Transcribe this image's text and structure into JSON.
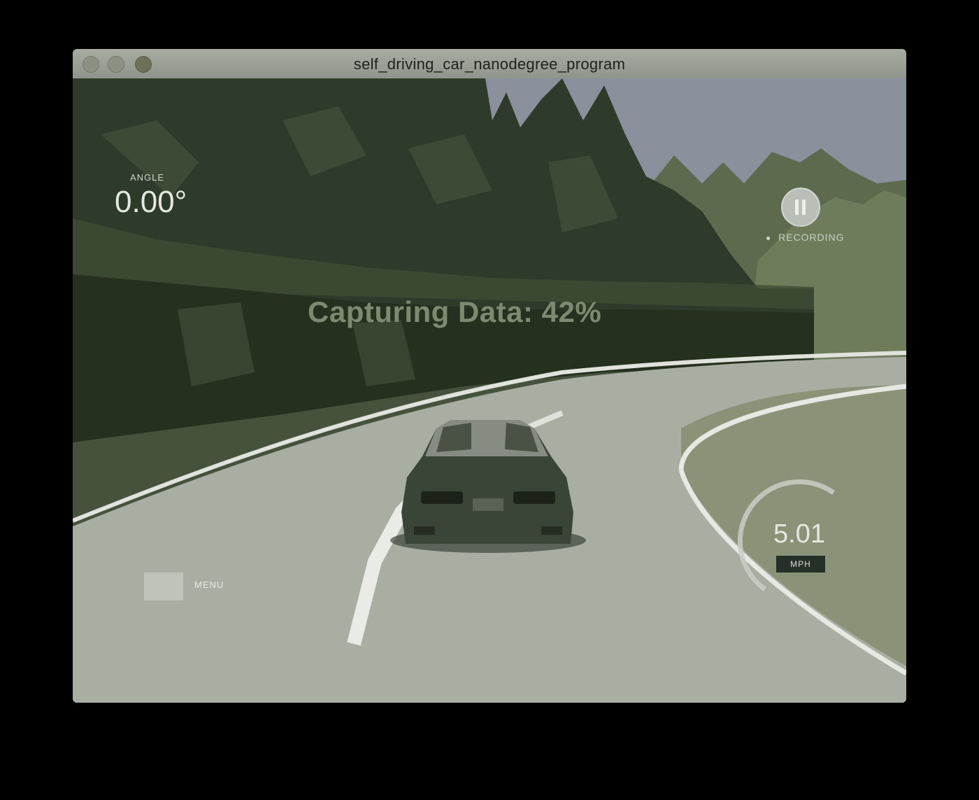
{
  "window": {
    "title": "self_driving_car_nanodegree_program"
  },
  "hud": {
    "angle_label": "ANGLE",
    "angle_value": "0.00°",
    "capture_text": "Capturing Data: 42%",
    "capture_progress": 0.42,
    "recording_label": "RECORDING",
    "recording_icon": "pause-icon",
    "menu_label": "MENU",
    "speed_value": "5.01",
    "speed_unit": "MPH"
  }
}
